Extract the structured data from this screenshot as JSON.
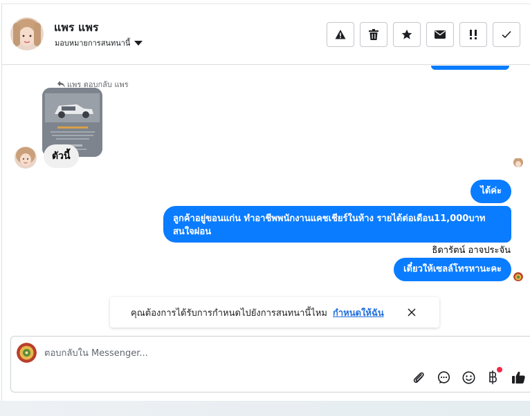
{
  "header": {
    "contact_name": "แพร แพร",
    "assign_label": "มอบหมายการสนทนานี้",
    "actions": [
      "spam",
      "delete",
      "star",
      "mark-unread",
      "follow-up",
      "done"
    ]
  },
  "chat": {
    "reply_note": "แพร ตอบกลับ แพร",
    "incoming_message": "ตัวนี้",
    "outgoing": [
      "ได้ค่ะ",
      "ลูกค้าอยู่ขอนแก่น ทำอาชีพพนักงานแคชเชียร์ในห้าง รายได้ต่อเดือน11,000บาท สนใจผ่อน",
      "เดี๋ยวให้เซลล์โทรหานะคะ"
    ],
    "sender_name": "ธิดารัตน์ อาจประจัน"
  },
  "notify": {
    "text": "คุณต้องการได้รับการกำหนดไปยังการสนทนานี้ไหม",
    "link": "กำหนดให้ฉัน"
  },
  "composer": {
    "placeholder": "ตอบกลับใน Messenger...",
    "icons": [
      "paperclip-icon",
      "chat-bubble-icon",
      "emoji-icon",
      "baht-icon",
      "thumbs-up-icon"
    ]
  },
  "colors": {
    "outgoing_bubble": "#0a7cff",
    "incoming_bubble": "#f0f0f0",
    "link": "#216fdb"
  }
}
